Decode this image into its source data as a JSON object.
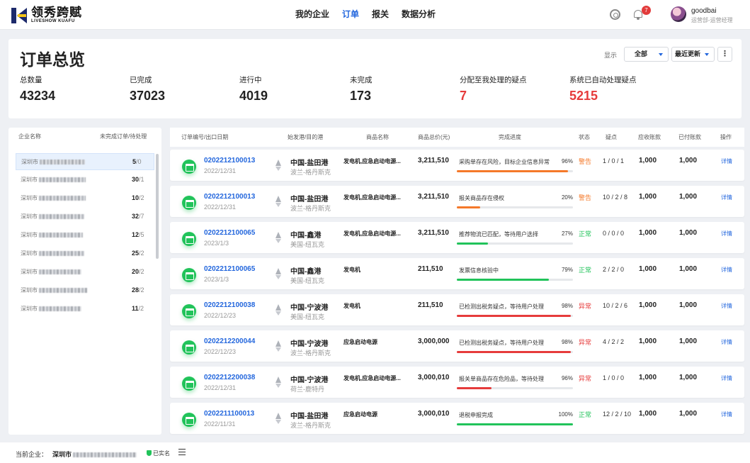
{
  "brand": {
    "name": "领秀跨赋",
    "sub": "LIVESHOW KUAFU"
  },
  "nav": [
    {
      "label": "我的企业",
      "active": false
    },
    {
      "label": "订单",
      "active": true
    },
    {
      "label": "报关",
      "active": false
    },
    {
      "label": "数据分析",
      "active": false
    }
  ],
  "notifications": {
    "count": "7"
  },
  "user": {
    "name": "goodbai",
    "role": "运营部-运营经理"
  },
  "overview": {
    "title": "订单总览",
    "show_label": "显示",
    "filter_value": "全部",
    "sort_value": "最近更新",
    "more_label": "⋮",
    "stats": [
      {
        "label": "总数量",
        "value": "43234",
        "red": false
      },
      {
        "label": "已完成",
        "value": "37023",
        "red": false
      },
      {
        "label": "进行中",
        "value": "4019",
        "red": false
      },
      {
        "label": "未完成",
        "value": "173",
        "red": false
      },
      {
        "label": "分配至我处理的疑点",
        "value": "7",
        "red": true
      },
      {
        "label": "系统已自动处理疑点",
        "value": "5215",
        "red": true
      }
    ]
  },
  "companies": {
    "header_name": "企业名称",
    "header_count": "未完成订单/待处理",
    "prefix": "深圳市",
    "rows": [
      {
        "count": "5",
        "pending": "/0",
        "selected": true
      },
      {
        "count": "30",
        "pending": "/1",
        "selected": false
      },
      {
        "count": "10",
        "pending": "/2",
        "selected": false
      },
      {
        "count": "32",
        "pending": "/7",
        "selected": false
      },
      {
        "count": "12",
        "pending": "/5",
        "selected": false
      },
      {
        "count": "25",
        "pending": "/2",
        "selected": false
      },
      {
        "count": "20",
        "pending": "/2",
        "selected": false
      },
      {
        "count": "28",
        "pending": "/2",
        "selected": false
      },
      {
        "count": "11",
        "pending": "/2",
        "selected": false
      }
    ]
  },
  "table": {
    "headers": {
      "order": "订单编号/出口日期",
      "route": "始发港/目的港",
      "product": "商品名称",
      "amount": "商品总价(元)",
      "progress": "完成进度",
      "status": "状态",
      "issues": "疑点",
      "receivable": "应收账款",
      "paid": "已付账款",
      "action": "操作"
    },
    "rows": [
      {
        "id": "0202212100013",
        "date": "2022/12/31",
        "from": "中国-盐田港",
        "to": "波兰-格丹斯克",
        "product": "发电机,应急启动电源...",
        "amount": "3,211,510",
        "desc": "采购单存在风险，目标企业信息异常",
        "pct": "96%",
        "progress": 0.96,
        "bar_color": "#f5792a",
        "status": "警告",
        "status_color": "#f5792a",
        "issues": "1 / 0 / 1",
        "receivable": "1,000",
        "paid": "1,000",
        "action": "详情"
      },
      {
        "id": "0202212100013",
        "date": "2022/12/31",
        "from": "中国-盐田港",
        "to": "波兰-格丹斯克",
        "product": "发电机,应急启动电源...",
        "amount": "3,211,510",
        "desc": "报关商品存在侵权",
        "pct": "20%",
        "progress": 0.2,
        "bar_color": "#f5792a",
        "status": "警告",
        "status_color": "#f5792a",
        "issues": "10 / 2 / 8",
        "receivable": "1,000",
        "paid": "1,000",
        "action": "详情"
      },
      {
        "id": "0202212100065",
        "date": "2023/1/3",
        "from": "中国-鑫港",
        "to": "美国-纽瓦克",
        "product": "发电机,应急启动电源...",
        "amount": "3,211,510",
        "desc": "推荐物流已匹配，等待用户选择",
        "pct": "27%",
        "progress": 0.27,
        "bar_color": "#21c35a",
        "status": "正常",
        "status_color": "#21c35a",
        "issues": "0 / 0 / 0",
        "receivable": "1,000",
        "paid": "1,000",
        "action": "详情"
      },
      {
        "id": "0202212100065",
        "date": "2023/1/3",
        "from": "中国-鑫港",
        "to": "美国-纽瓦克",
        "product": "发电机",
        "amount": "211,510",
        "desc": "发票信息核验中",
        "pct": "79%",
        "progress": 0.79,
        "bar_color": "#21c35a",
        "status": "正常",
        "status_color": "#21c35a",
        "issues": "2 / 2 / 0",
        "receivable": "1,000",
        "paid": "1,000",
        "action": "详情"
      },
      {
        "id": "0202212100038",
        "date": "2022/12/23",
        "from": "中国-宁波港",
        "to": "美国-纽瓦克",
        "product": "发电机",
        "amount": "211,510",
        "desc": "已检测出税务疑点，等待用户处理",
        "pct": "98%",
        "progress": 0.98,
        "bar_color": "#e63b3b",
        "status": "异常",
        "status_color": "#e63b3b",
        "issues": "10 / 2 / 6",
        "receivable": "1,000",
        "paid": "1,000",
        "action": "详情"
      },
      {
        "id": "0202212200044",
        "date": "2022/12/23",
        "from": "中国-宁波港",
        "to": "波兰-格丹斯克",
        "product": "应急启动电源",
        "amount": "3,000,000",
        "desc": "已检测出税务疑点，等待用户处理",
        "pct": "98%",
        "progress": 0.98,
        "bar_color": "#e63b3b",
        "status": "异常",
        "status_color": "#e63b3b",
        "issues": "4 / 2 / 2",
        "receivable": "1,000",
        "paid": "1,000",
        "action": "详情"
      },
      {
        "id": "0202212200038",
        "date": "2022/12/31",
        "from": "中国-宁波港",
        "to": "荷兰-鹿特丹",
        "product": "发电机,应急启动电源...",
        "amount": "3,000,010",
        "desc": "报关单商品存在危险品，等待处理",
        "pct": "96%",
        "progress": 0.3,
        "bar_color": "#e63b3b",
        "status": "异常",
        "status_color": "#e63b3b",
        "issues": "1 / 0 / 0",
        "receivable": "1,000",
        "paid": "1,000",
        "action": "详情"
      },
      {
        "id": "0202211100013",
        "date": "2022/11/31",
        "from": "中国-盐田港",
        "to": "波兰-格丹斯克",
        "product": "应急启动电源",
        "amount": "3,000,010",
        "desc": "退税申报完成",
        "pct": "100%",
        "progress": 1.0,
        "bar_color": "#21c35a",
        "status": "正常",
        "status_color": "#21c35a",
        "issues": "12 / 2 / 10",
        "receivable": "1,000",
        "paid": "1,000",
        "action": "详情"
      }
    ]
  },
  "footer": {
    "label": "当前企业：",
    "company_prefix": "深圳市",
    "verified": "已实名"
  }
}
